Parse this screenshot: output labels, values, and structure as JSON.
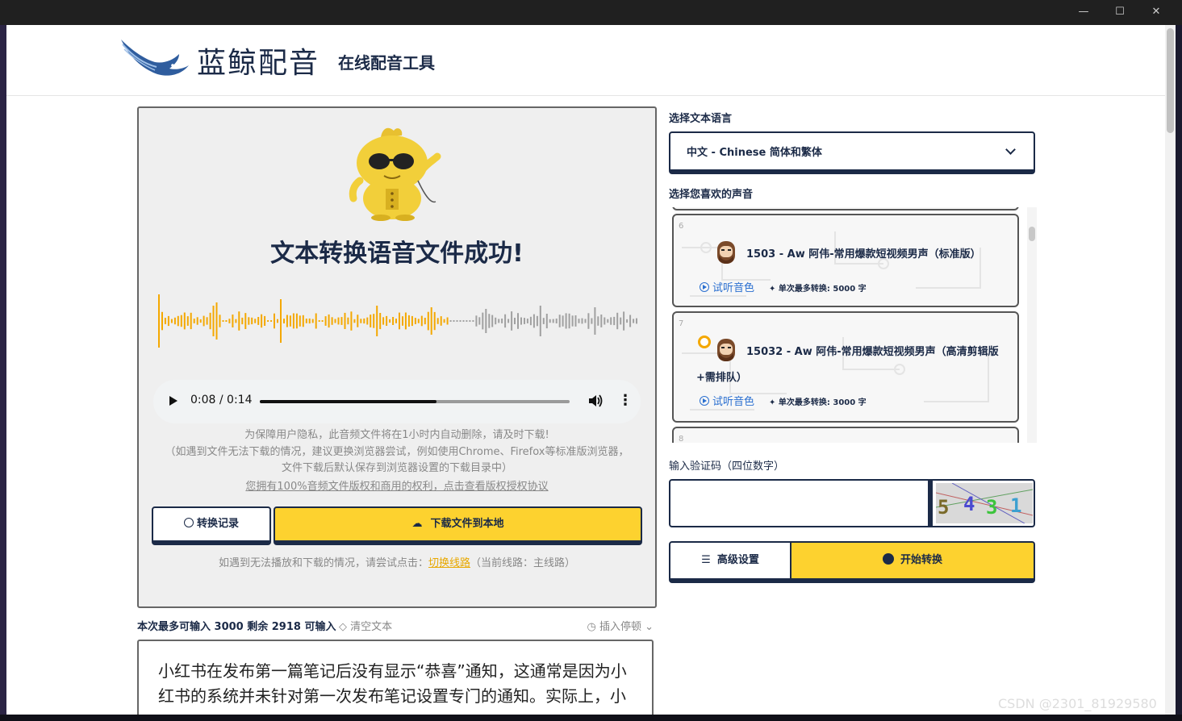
{
  "window": {
    "minimize_icon": "minimize-icon",
    "maximize_icon": "maximize-icon",
    "close_icon": "close-icon"
  },
  "header": {
    "logo_text": "蓝鲸配音",
    "subtitle": "在线配音工具"
  },
  "result": {
    "title": "文本转换语音文件成功!",
    "audio_time": "0:08 / 0:14",
    "audio_progress": 0.571,
    "privacy_note": "为保障用户隐私，此音频文件将在1小时内自动删除，请及时下载!",
    "browser_note": "（如遇到文件无法下载的情况，建议更换浏览器尝试，例如使用Chrome、Firefox等标准版浏览器，文件下载后默认保存到浏览器设置的下载目录中）",
    "license_link": "您拥有100%音频文件版权和商用的权利，点击查看版权授权协议",
    "history_button": "转换记录",
    "download_button": "下载文件到本地",
    "switch_prefix": "如遇到无法播放和下载的情况，请尝试点击：",
    "switch_link": "切换线路",
    "switch_suffix": "（当前线路：主线路）"
  },
  "text_input": {
    "limit_text": "本次最多可输入 3000 剩余 2918 可输入",
    "clear_label": "清空文本",
    "insert_pause_label": "插入停顿",
    "content": "小红书在发布第一篇笔记后没有显示“恭喜”通知，这通常是因为小红书的系统并未针对第一次发布笔记设置专门的通知。实际上，小"
  },
  "language": {
    "label": "选择文本语言",
    "selected": "中文 - Chinese 简体和繁体"
  },
  "voices": {
    "label": "选择您喜欢的声音",
    "items": [
      {
        "num": "6",
        "name": "1503 - Aw 阿伟-常用爆款短视频男声（标准版）",
        "name_cont": "",
        "listen": "试听音色",
        "max_chars": "单次最多转换: 5000 字",
        "selected": false
      },
      {
        "num": "7",
        "name": "15032 - Aw 阿伟-常用爆款短视频男声（高清剪辑版",
        "name_cont": "+需排队）",
        "listen": "试听音色",
        "max_chars": "单次最多转换: 3000 字",
        "selected": true
      },
      {
        "num": "8",
        "name": "",
        "name_cont": "",
        "listen": "",
        "max_chars": "",
        "selected": false
      }
    ]
  },
  "captcha": {
    "label": "输入验证码（四位数字）",
    "value": "",
    "digits": [
      "5",
      "4",
      "3",
      "1"
    ],
    "digit_colors": [
      "#7a6a2a",
      "#4a4ad0",
      "#3cc43c",
      "#3ca0d0"
    ]
  },
  "actions": {
    "advanced_button": "高级设置",
    "start_button": "开始转换"
  },
  "watermark": "CSDN @2301_81929580",
  "colors": {
    "accent": "#fdd22f",
    "navy": "#1b2a47",
    "link_blue": "#2a6fd0",
    "wave_played": "#f4a800",
    "wave_unplayed": "#a0a0a0"
  }
}
